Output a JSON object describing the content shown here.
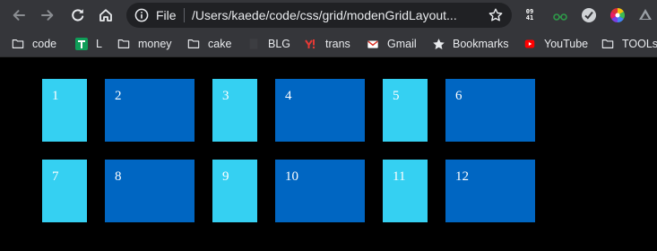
{
  "browser": {
    "omnibox": {
      "scheme_label": "File",
      "url": "/Users/kaede/code/css/grid/modenGridLayout..."
    },
    "extensions": {
      "clock_text": [
        "09",
        "41"
      ]
    }
  },
  "bookmarks": [
    {
      "label": "code",
      "icon": "folder-icon"
    },
    {
      "label": "L",
      "icon": "green-app-icon"
    },
    {
      "label": "money",
      "icon": "folder-icon"
    },
    {
      "label": "cake",
      "icon": "folder-icon"
    },
    {
      "label": "BLG",
      "icon": "blank-page-icon"
    },
    {
      "label": "trans",
      "icon": "yahoo-icon"
    },
    {
      "label": "Gmail",
      "icon": "gmail-icon"
    },
    {
      "label": "Bookmarks",
      "icon": "star-icon"
    },
    {
      "label": "YouTube",
      "icon": "youtube-icon"
    },
    {
      "label": "TOOLs",
      "icon": "folder-icon"
    }
  ],
  "grid": {
    "colors": {
      "light": "#35d0f2",
      "dark": "#0066c2",
      "background": "#000000"
    },
    "rows": [
      [
        "1",
        "2",
        "3",
        "4",
        "5",
        "6"
      ],
      [
        "7",
        "8",
        "9",
        "10",
        "11",
        "12"
      ]
    ]
  }
}
